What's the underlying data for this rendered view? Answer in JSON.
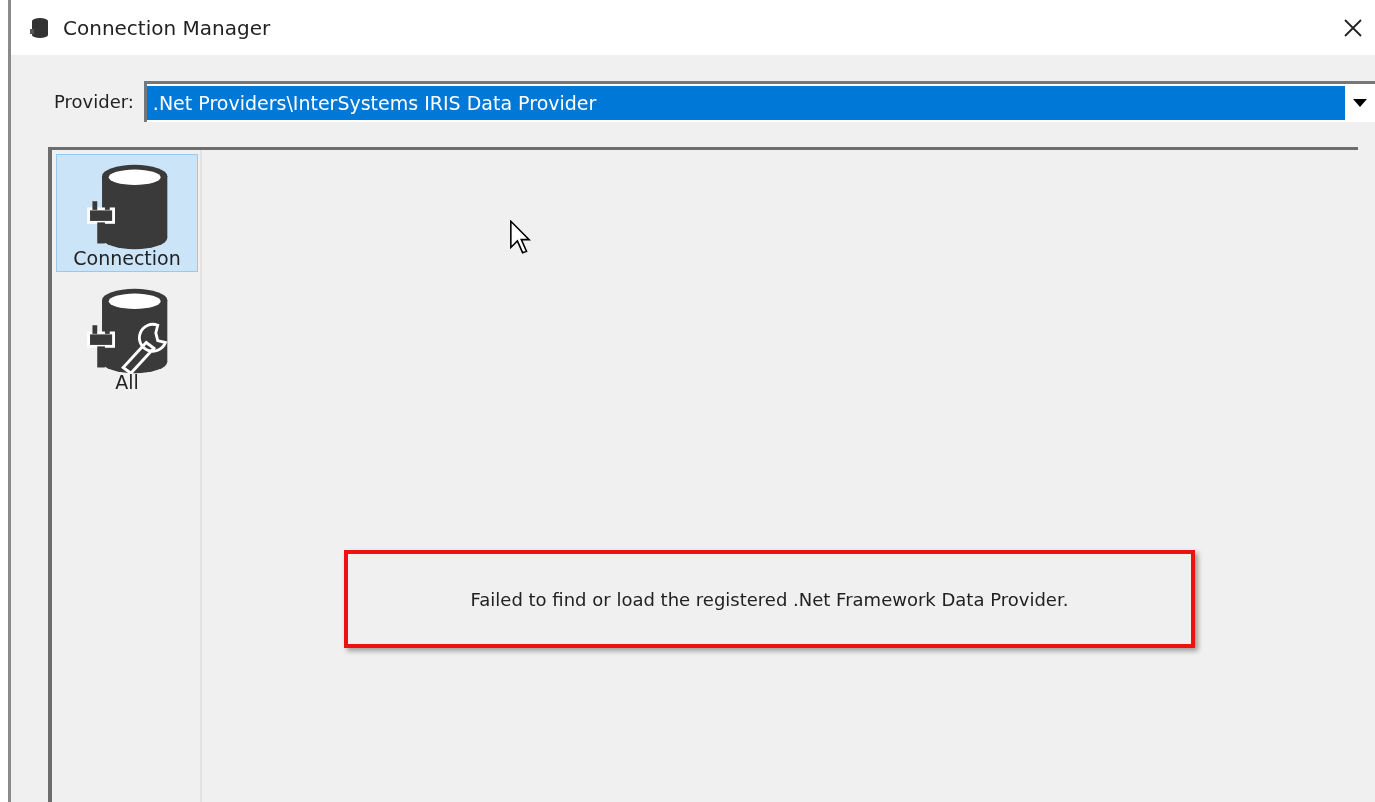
{
  "window": {
    "title": "Connection Manager"
  },
  "provider": {
    "label": "Provider:",
    "value": ".Net Providers\\InterSystems IRIS Data Provider"
  },
  "sidebar": {
    "items": [
      {
        "label": "Connection",
        "kind": "connection",
        "selected": true
      },
      {
        "label": "All",
        "kind": "all",
        "selected": false
      }
    ]
  },
  "message": {
    "text": "Failed to find or load the registered .Net Framework Data Provider.",
    "highlighted": true
  }
}
